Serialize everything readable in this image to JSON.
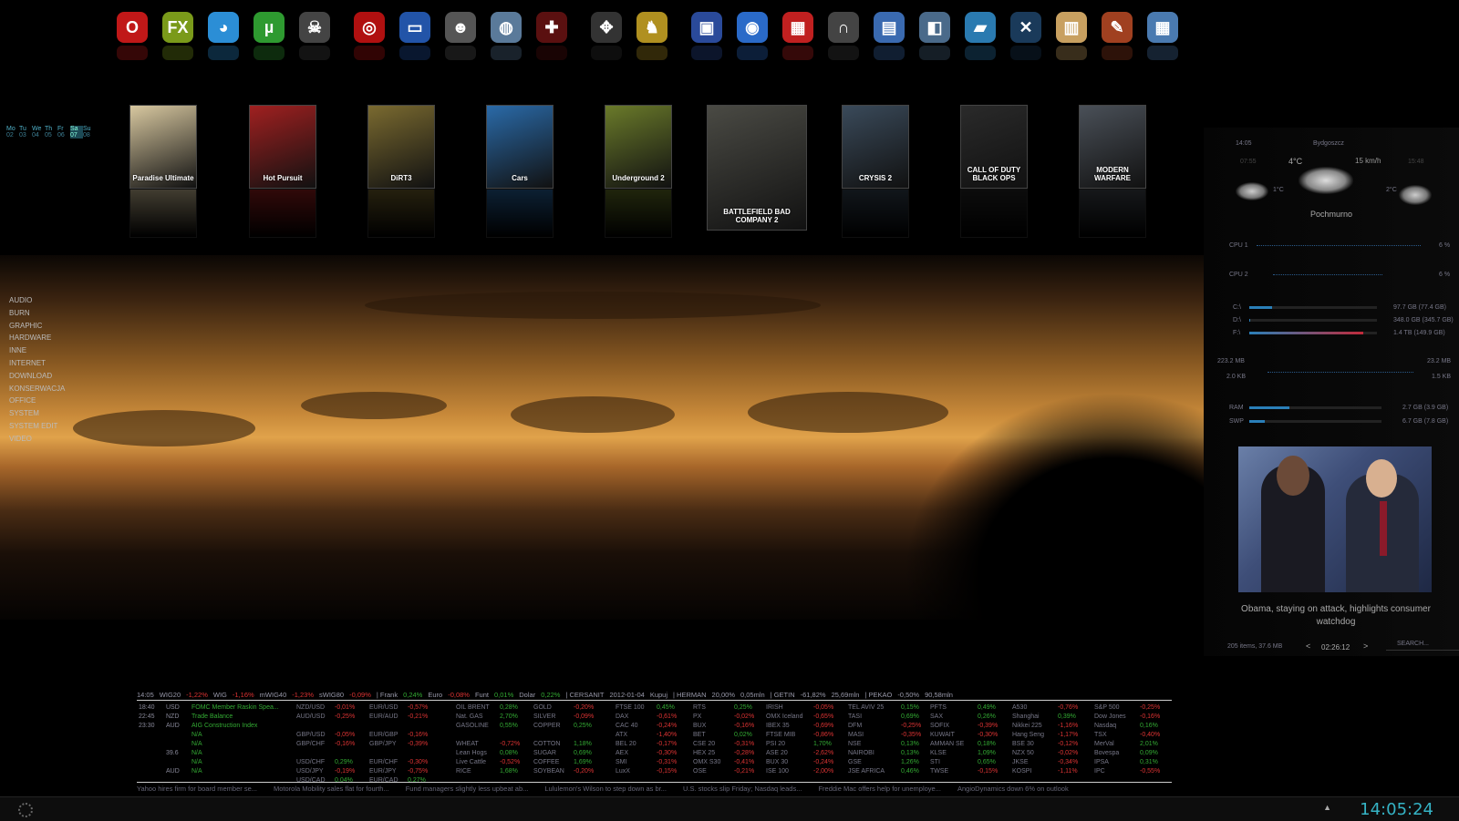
{
  "dock": [
    {
      "icon": "opera-icon",
      "glyph": "O",
      "color": "#c01818"
    },
    {
      "icon": "firefox-icon",
      "glyph": "FX",
      "color": "#7a9a1a"
    },
    {
      "icon": "messenger-icon",
      "glyph": "◕",
      "color": "#2b8ed6"
    },
    {
      "icon": "utorrent-icon",
      "glyph": "µ",
      "color": "#2e9a30"
    },
    {
      "icon": "pirate-icon",
      "glyph": "☠",
      "color": "#444"
    },
    {
      "icon": "target-icon",
      "glyph": "◎",
      "color": "#b01010"
    },
    {
      "icon": "aimp-icon",
      "glyph": "▭",
      "color": "#2254a8"
    },
    {
      "icon": "skull-icon",
      "glyph": "☻",
      "color": "#555"
    },
    {
      "icon": "globe-icon",
      "glyph": "◍",
      "color": "#5a7a9a"
    },
    {
      "icon": "gamepad-red-icon",
      "glyph": "✚",
      "color": "#5a1010"
    },
    {
      "icon": "gamepad-icon",
      "glyph": "✥",
      "color": "#333"
    },
    {
      "icon": "rabbit-icon",
      "glyph": "♞",
      "color": "#b09020"
    },
    {
      "icon": "monitor-icon",
      "glyph": "▣",
      "color": "#2a4a9a"
    },
    {
      "icon": "disc-icon",
      "glyph": "◉",
      "color": "#2a6ac8"
    },
    {
      "icon": "toolbox-icon",
      "glyph": "▦",
      "color": "#c02020"
    },
    {
      "icon": "headphones-icon",
      "glyph": "∩",
      "color": "#444"
    },
    {
      "icon": "clapper-icon",
      "glyph": "▤",
      "color": "#3a6ab0"
    },
    {
      "icon": "wallet-icon",
      "glyph": "◧",
      "color": "#4a6a8a"
    },
    {
      "icon": "folder-icon",
      "glyph": "▰",
      "color": "#2a7ab0"
    },
    {
      "icon": "close-circle-icon",
      "glyph": "✕",
      "color": "#1a3a5a"
    },
    {
      "icon": "notepad-icon",
      "glyph": "▥",
      "color": "#c8a060"
    },
    {
      "icon": "palette-icon",
      "glyph": "✎",
      "color": "#a04020"
    },
    {
      "icon": "calculator-icon",
      "glyph": "▦",
      "color": "#4a7ab0"
    }
  ],
  "games": [
    {
      "title": "Paradise Ultimate",
      "color": "#d8c8a0"
    },
    {
      "title": "Hot Pursuit",
      "color": "#a02020"
    },
    {
      "title": "DiRT3",
      "color": "#7a6a30"
    },
    {
      "title": "Cars",
      "color": "#2a6aa8"
    },
    {
      "title": "Underground 2",
      "color": "#6a7a2a"
    },
    {
      "title": "BATTLEFIELD BAD COMPANY 2",
      "color": "#4a4a44"
    },
    {
      "title": "CRYSIS 2",
      "color": "#3a4a5a"
    },
    {
      "title": "CALL OF DUTY BLACK OPS",
      "color": "#2a2a2a"
    },
    {
      "title": "MODERN WARFARE",
      "color": "#4a5058"
    }
  ],
  "calendar": {
    "days": [
      "Mo",
      "Tu",
      "We",
      "Th",
      "Fr",
      "Sa",
      "Su"
    ],
    "nums": [
      "02",
      "03",
      "04",
      "05",
      "06",
      "07",
      "08"
    ]
  },
  "menu": [
    "AUDIO",
    "BURN",
    "GRAPHIC",
    "HARDWARE",
    "INNE",
    "INTERNET",
    "DOWNLOAD",
    "KONSERWACJA",
    "OFFICE",
    "SYSTEM",
    "SYSTEM EDIT",
    "VIDEO"
  ],
  "weather": {
    "time": "14:05",
    "city": "Bydgoszcz",
    "temp": "4°C",
    "wind": "15 km/h",
    "sunrise": "07:55",
    "sunset": "15:48",
    "low1": "1°C",
    "low2": "2°C",
    "desc": "Pochmurno"
  },
  "monitor": {
    "cpu1": "CPU 1",
    "cpu1_val": "6 %",
    "cpu2": "CPU 2",
    "cpu2_val": "6 %",
    "drives": [
      {
        "label": "C:\\",
        "value": "97.7 GB (77.4 GB)",
        "fill": 0.18
      },
      {
        "label": "D:\\",
        "value": "348.0 GB (345.7 GB)",
        "fill": 0.01
      },
      {
        "label": "F:\\",
        "value": "1.4 TB (149.9 GB)",
        "fill": 0.89
      }
    ],
    "net_down_total": "223.2 MB",
    "net_up_total": "23.2 MB",
    "net_down": "2.0 KB",
    "net_up": "1.5 KB",
    "ram_label": "RAM",
    "ram_value": "2.7 GB (3.9 GB)",
    "ram_fill": 0.3,
    "swp_label": "SWP",
    "swp_value": "6.7 GB (7.8 GB)",
    "swp_fill": 0.12
  },
  "news": {
    "caption": "Obama, staying on attack, highlights consumer watchdog",
    "items": "205 items, 37.6 MB",
    "time": "02:26:12",
    "search": "SEARCH..."
  },
  "ticker_head": [
    {
      "t": "14:05",
      "c": ""
    },
    {
      "t": "WIG20",
      "c": ""
    },
    {
      "t": "-1,22%",
      "c": "neg"
    },
    {
      "t": "WIG",
      "c": ""
    },
    {
      "t": "-1,16%",
      "c": "neg"
    },
    {
      "t": "mWIG40",
      "c": ""
    },
    {
      "t": "-1,23%",
      "c": "neg"
    },
    {
      "t": "sWIG80",
      "c": ""
    },
    {
      "t": "-0,09%",
      "c": "neg"
    },
    {
      "t": "|  Frank",
      "c": ""
    },
    {
      "t": "0,24%",
      "c": "pos"
    },
    {
      "t": "Euro",
      "c": ""
    },
    {
      "t": "-0,08%",
      "c": "neg"
    },
    {
      "t": "Funt",
      "c": ""
    },
    {
      "t": "0,01%",
      "c": "pos"
    },
    {
      "t": "Dolar",
      "c": ""
    },
    {
      "t": "0,22%",
      "c": "pos"
    },
    {
      "t": "|  CERSANIT",
      "c": ""
    },
    {
      "t": "2012-01-04",
      "c": ""
    },
    {
      "t": "Kupuj",
      "c": ""
    },
    {
      "t": "|  HERMAN",
      "c": ""
    },
    {
      "t": "20,00%",
      "c": ""
    },
    {
      "t": "0,05mln",
      "c": ""
    },
    {
      "t": "|  GETIN",
      "c": ""
    },
    {
      "t": "-61,82%",
      "c": ""
    },
    {
      "t": "25,69mln",
      "c": ""
    },
    {
      "t": "|  PEKAO",
      "c": ""
    },
    {
      "t": "-0,50%",
      "c": ""
    },
    {
      "t": "90,58mln",
      "c": ""
    }
  ],
  "calendar_events": [
    {
      "time": "18:40",
      "cur": "USD",
      "text": "FOMC Member Raskin Spea..."
    },
    {
      "time": "22:45",
      "cur": "NZD",
      "text": "Trade Balance"
    },
    {
      "time": "23:30",
      "cur": "AUD",
      "text": "AIG Construction Index"
    },
    {
      "time": "",
      "cur": "",
      "text": "N/A"
    },
    {
      "time": "",
      "cur": "",
      "text": "N/A"
    },
    {
      "time": "",
      "cur": "39.6",
      "text": "N/A"
    },
    {
      "time": "",
      "cur": "",
      "text": "N/A"
    },
    {
      "time": "",
      "cur": "AUD",
      "text": "N/A"
    }
  ],
  "fx1": [
    {
      "n": "NZD/USD",
      "v": "-0,01%"
    },
    {
      "n": "AUD/USD",
      "v": "-0,25%"
    },
    {
      "n": "",
      "v": ""
    },
    {
      "n": "GBP/USD",
      "v": "-0,05%"
    },
    {
      "n": "GBP/CHF",
      "v": "-0,16%"
    },
    {
      "n": "",
      "v": ""
    },
    {
      "n": "USD/CHF",
      "v": "0,29%"
    },
    {
      "n": "USD/JPY",
      "v": "-0,19%"
    },
    {
      "n": "USD/CAD",
      "v": "0,04%"
    }
  ],
  "fx2": [
    {
      "n": "EUR/USD",
      "v": "-0,57%"
    },
    {
      "n": "EUR/AUD",
      "v": "-0,21%"
    },
    {
      "n": "",
      "v": ""
    },
    {
      "n": "EUR/GBP",
      "v": "-0,16%"
    },
    {
      "n": "GBP/JPY",
      "v": "-0,39%"
    },
    {
      "n": "",
      "v": ""
    },
    {
      "n": "EUR/CHF",
      "v": "-0,30%"
    },
    {
      "n": "EUR/JPY",
      "v": "-0,75%"
    },
    {
      "n": "EUR/CAD",
      "v": "0,27%"
    }
  ],
  "commodities1": [
    {
      "n": "OIL BRENT",
      "v": "0,28%"
    },
    {
      "n": "Nat. GAS",
      "v": "2,70%"
    },
    {
      "n": "GASOLINE",
      "v": "0,55%"
    },
    {
      "n": "",
      "v": ""
    },
    {
      "n": "WHEAT",
      "v": "-0,72%"
    },
    {
      "n": "Lean Hogs",
      "v": "0,08%"
    },
    {
      "n": "Live Cattle",
      "v": "-0,52%"
    },
    {
      "n": "RICE",
      "v": "1,68%"
    }
  ],
  "commodities2": [
    {
      "n": "GOLD",
      "v": "-0,20%"
    },
    {
      "n": "SILVER",
      "v": "-0,09%"
    },
    {
      "n": "COPPER",
      "v": "0,25%"
    },
    {
      "n": "",
      "v": ""
    },
    {
      "n": "COTTON",
      "v": "1,18%"
    },
    {
      "n": "SUGAR",
      "v": "0,69%"
    },
    {
      "n": "COFFEE",
      "v": "1,69%"
    },
    {
      "n": "SOYBEAN",
      "v": "-0,20%"
    }
  ],
  "idx1": [
    {
      "n": "FTSE 100",
      "v": "0,45%"
    },
    {
      "n": "DAX",
      "v": "-0,61%"
    },
    {
      "n": "CAC 40",
      "v": "-0,24%"
    },
    {
      "n": "ATX",
      "v": "-1,40%"
    },
    {
      "n": "BEL 20",
      "v": "-0,17%"
    },
    {
      "n": "AEX",
      "v": "-0,30%"
    },
    {
      "n": "SMI",
      "v": "-0,31%"
    },
    {
      "n": "LuxX",
      "v": "-0,15%"
    }
  ],
  "idx2": [
    {
      "n": "RTS",
      "v": "0,25%"
    },
    {
      "n": "PX",
      "v": "-0,02%"
    },
    {
      "n": "BUX",
      "v": "-0,16%"
    },
    {
      "n": "BET",
      "v": "0,02%"
    },
    {
      "n": "CSE 20",
      "v": "-0,31%"
    },
    {
      "n": "HEX 25",
      "v": "-0,28%"
    },
    {
      "n": "OMX S30",
      "v": "-0,41%"
    },
    {
      "n": "OSE",
      "v": "-0,21%"
    }
  ],
  "idx3": [
    {
      "n": "IRISH",
      "v": "-0,05%"
    },
    {
      "n": "OMX Iceland",
      "v": "-0,65%"
    },
    {
      "n": "IBEX 35",
      "v": "-0,69%"
    },
    {
      "n": "FTSE MIB",
      "v": "-0,86%"
    },
    {
      "n": "PSI 20",
      "v": "1,70%"
    },
    {
      "n": "ASE 20",
      "v": "-2,62%"
    },
    {
      "n": "BUX 30",
      "v": "-0,24%"
    },
    {
      "n": "ISE 100",
      "v": "-2,00%"
    }
  ],
  "idx4": [
    {
      "n": "TEL AVIV 25",
      "v": "0,15%"
    },
    {
      "n": "TASI",
      "v": "0,69%"
    },
    {
      "n": "DFM",
      "v": "-0,25%"
    },
    {
      "n": "MASI",
      "v": "-0,35%"
    },
    {
      "n": "NSE",
      "v": "0,13%"
    },
    {
      "n": "NAIROBI",
      "v": "0,13%"
    },
    {
      "n": "GSE",
      "v": "1,26%"
    },
    {
      "n": "JSE AFRICA",
      "v": "0,46%"
    }
  ],
  "idx5": [
    {
      "n": "PFTS",
      "v": "0,49%"
    },
    {
      "n": "SAX",
      "v": "0,26%"
    },
    {
      "n": "SOFIX",
      "v": "-0,39%"
    },
    {
      "n": "KUWAIT",
      "v": "-0,30%"
    },
    {
      "n": "AMMAN SE",
      "v": "0,18%"
    },
    {
      "n": "KLSE",
      "v": "1,09%"
    },
    {
      "n": "STI",
      "v": "0,65%"
    },
    {
      "n": "TWSE",
      "v": "-0,15%"
    }
  ],
  "idx6": [
    {
      "n": "A530",
      "v": "-0,76%"
    },
    {
      "n": "Shanghai",
      "v": "0,39%"
    },
    {
      "n": "Nikkei 225",
      "v": "-1,16%"
    },
    {
      "n": "Hang Seng",
      "v": "-1,17%"
    },
    {
      "n": "BSE 30",
      "v": "-0,12%"
    },
    {
      "n": "NZX 50",
      "v": "-0,02%"
    },
    {
      "n": "JKSE",
      "v": "-0,34%"
    },
    {
      "n": "KOSPI",
      "v": "-1,11%"
    }
  ],
  "idx7": [
    {
      "n": "S&P 500",
      "v": "-0,25%"
    },
    {
      "n": "Dow Jones",
      "v": "-0,16%"
    },
    {
      "n": "Nasdaq",
      "v": "0,16%"
    },
    {
      "n": "TSX",
      "v": "-0,40%"
    },
    {
      "n": "MerVal",
      "v": "2,01%"
    },
    {
      "n": "Bovespa",
      "v": "0,09%"
    },
    {
      "n": "IPSA",
      "v": "0,31%"
    },
    {
      "n": "IPC",
      "v": "-0,55%"
    }
  ],
  "headlines": [
    "Yahoo hires firm for board member se...",
    "Motorola Mobility sales flat for fourth...",
    "Fund managers slightly less upbeat ab...",
    "Lululemon's Wilson to step down as br...",
    "U.S. stocks slip Friday; Nasdaq leads...",
    "Freddie Mac offers help for unemploye...",
    "AngioDynamics down 6% on outlook"
  ],
  "clock": "14:05:24"
}
